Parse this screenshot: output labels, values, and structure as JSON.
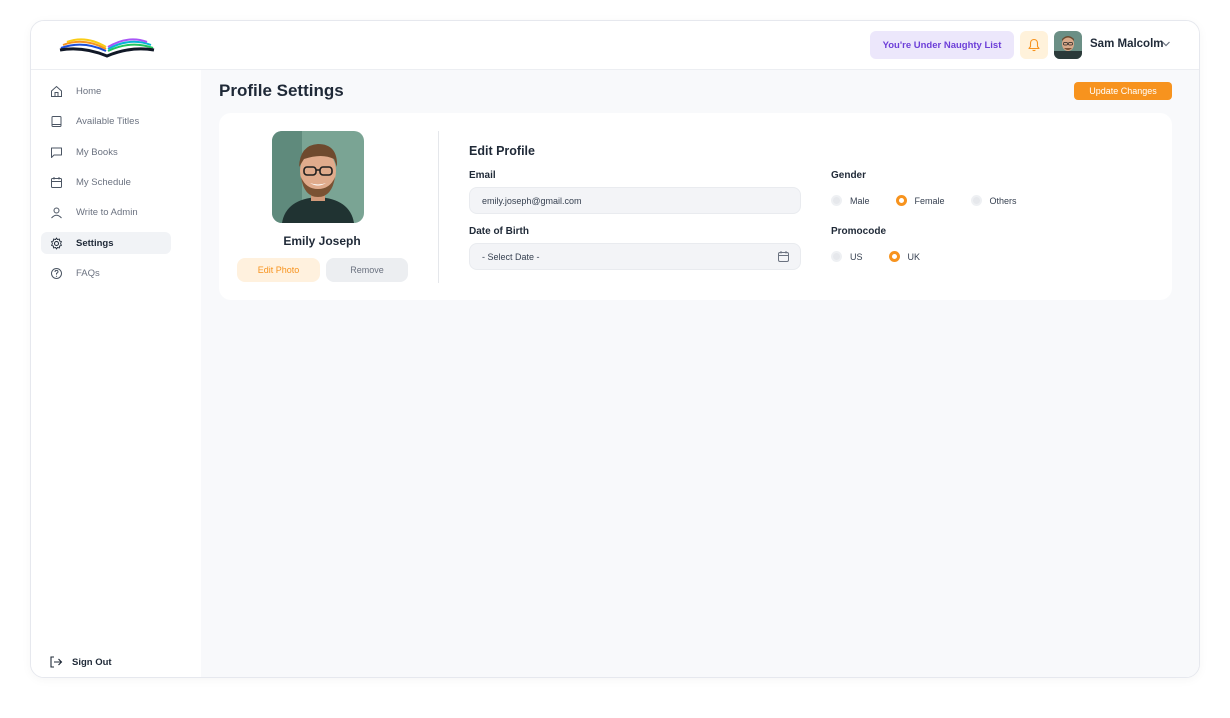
{
  "header": {
    "naughty_badge": "You're Under Naughty List",
    "user_name": "Sam Malcolm"
  },
  "sidebar": {
    "items": [
      {
        "label": "Home",
        "icon": "home-icon"
      },
      {
        "label": "Available Titles",
        "icon": "book-icon"
      },
      {
        "label": "My Books",
        "icon": "chat-bubble-icon"
      },
      {
        "label": "My Schedule",
        "icon": "calendar-icon"
      },
      {
        "label": "Write to Admin",
        "icon": "user-icon"
      },
      {
        "label": "Settings",
        "icon": "gear-icon",
        "active": true
      },
      {
        "label": "FAQs",
        "icon": "question-icon"
      }
    ],
    "signout": "Sign Out"
  },
  "main": {
    "title": "Profile Settings",
    "update_button": "Update Changes",
    "profile": {
      "name": "Emily Joseph",
      "edit_photo": "Edit Photo",
      "remove": "Remove"
    },
    "form": {
      "heading": "Edit Profile",
      "email_label": "Email",
      "email_value": "emily.joseph@gmail.com",
      "dob_label": "Date of Birth",
      "dob_value": "- Select Date -",
      "gender_label": "Gender",
      "gender_options": [
        "Male",
        "Female",
        "Others"
      ],
      "gender_selected": "Female",
      "promo_label": "Promocode",
      "promo_options": [
        "US",
        "UK"
      ],
      "promo_selected": "UK"
    }
  },
  "colors": {
    "accent": "#f7931e",
    "purple": "#6d3fd8",
    "background": "#f8f9fb"
  }
}
